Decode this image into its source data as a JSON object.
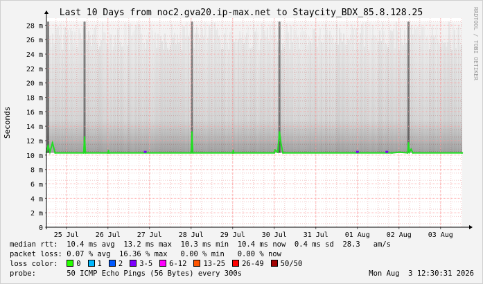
{
  "title": "Last 10 Days from noc2.gva20.ip-max.net to Staycity_BDX_85.8.128.25",
  "side_label": "RRDTOOL / TOBI OETIKER",
  "chart_data": {
    "type": "area",
    "ylabel": "Seconds",
    "ylim": [
      0,
      0.029
    ],
    "yticks": [
      {
        "v": 0,
        "label": "0"
      },
      {
        "v": 0.002,
        "label": "2 m"
      },
      {
        "v": 0.004,
        "label": "4 m"
      },
      {
        "v": 0.006,
        "label": "6 m"
      },
      {
        "v": 0.008,
        "label": "8 m"
      },
      {
        "v": 0.01,
        "label": "10 m"
      },
      {
        "v": 0.012,
        "label": "12 m"
      },
      {
        "v": 0.014,
        "label": "14 m"
      },
      {
        "v": 0.016,
        "label": "16 m"
      },
      {
        "v": 0.018,
        "label": "18 m"
      },
      {
        "v": 0.02,
        "label": "20 m"
      },
      {
        "v": 0.022,
        "label": "22 m"
      },
      {
        "v": 0.024,
        "label": "24 m"
      },
      {
        "v": 0.026,
        "label": "26 m"
      },
      {
        "v": 0.028,
        "label": "28 m"
      }
    ],
    "xlim": [
      "2026-07-24T12:30",
      "2026-08-03T12:30"
    ],
    "xticks": [
      {
        "t": "2026-07-25T00:00",
        "label": "25 Jul"
      },
      {
        "t": "2026-07-26T00:00",
        "label": "26 Jul"
      },
      {
        "t": "2026-07-27T00:00",
        "label": "27 Jul"
      },
      {
        "t": "2026-07-28T00:00",
        "label": "28 Jul"
      },
      {
        "t": "2026-07-29T00:00",
        "label": "29 Jul"
      },
      {
        "t": "2026-07-30T00:00",
        "label": "30 Jul"
      },
      {
        "t": "2026-07-31T00:00",
        "label": "31 Jul"
      },
      {
        "t": "2026-08-01T00:00",
        "label": "01 Aug"
      },
      {
        "t": "2026-08-02T00:00",
        "label": "02 Aug"
      },
      {
        "t": "2026-08-03T00:00",
        "label": "03 Aug"
      }
    ],
    "series": [
      {
        "name": "median rtt",
        "color": "#22dd22",
        "points": [
          [
            "2026-07-24T12:30",
            0.0104
          ],
          [
            "2026-07-24T13:30",
            0.0113
          ],
          [
            "2026-07-24T14:30",
            0.0104
          ],
          [
            "2026-07-24T16:00",
            0.0117
          ],
          [
            "2026-07-24T17:30",
            0.0103
          ],
          [
            "2026-07-25T10:00",
            0.0103
          ],
          [
            "2026-07-25T10:30",
            0.0125
          ],
          [
            "2026-07-25T11:00",
            0.0103
          ],
          [
            "2026-07-26T00:00",
            0.0103
          ],
          [
            "2026-07-26T00:20",
            0.0106
          ],
          [
            "2026-07-26T00:40",
            0.0103
          ],
          [
            "2026-07-28T00:00",
            0.0103
          ],
          [
            "2026-07-28T00:30",
            0.0132
          ],
          [
            "2026-07-28T01:00",
            0.0103
          ],
          [
            "2026-07-29T00:00",
            0.0103
          ],
          [
            "2026-07-29T00:20",
            0.0106
          ],
          [
            "2026-07-29T00:40",
            0.0103
          ],
          [
            "2026-07-30T00:00",
            0.0103
          ],
          [
            "2026-07-30T00:30",
            0.0107
          ],
          [
            "2026-07-30T02:00",
            0.0104
          ],
          [
            "2026-07-30T03:00",
            0.0132
          ],
          [
            "2026-07-30T04:00",
            0.0114
          ],
          [
            "2026-07-30T05:00",
            0.0103
          ],
          [
            "2026-08-01T20:00",
            0.0103
          ],
          [
            "2026-08-02T00:00",
            0.0104
          ],
          [
            "2026-08-02T00:30",
            0.0104
          ],
          [
            "2026-08-02T05:00",
            0.0103
          ],
          [
            "2026-08-02T05:30",
            0.0117
          ],
          [
            "2026-08-02T06:00",
            0.0104
          ],
          [
            "2026-08-02T07:00",
            0.0108
          ],
          [
            "2026-08-02T08:00",
            0.0103
          ],
          [
            "2026-08-03T12:30",
            0.0103
          ]
        ],
        "loss_markers": [
          {
            "t": "2026-07-26T21:30",
            "color": "#7e00ff"
          },
          {
            "t": "2026-08-01T00:00",
            "color": "#7e00ff"
          },
          {
            "t": "2026-08-01T17:00",
            "color": "#7e00ff"
          }
        ]
      }
    ],
    "smoke": {
      "base": 0.0103,
      "typical_top": 0.0285,
      "spikes": [
        "2026-07-24T13:30",
        "2026-07-25T10:30",
        "2026-07-28T00:30",
        "2026-07-30T03:00",
        "2026-08-02T05:30"
      ],
      "color": "#000000"
    }
  },
  "stats": {
    "median_rtt": {
      "label": "median rtt:",
      "text": "10.4 ms avg  13.2 ms max  10.3 ms min  10.4 ms now  0.4 ms sd  28.3   am/s"
    },
    "packet_loss": {
      "label": "packet loss:",
      "text": "0.07 % avg  16.36 % max   0.00 % min   0.00 % now"
    }
  },
  "loss_color": {
    "label": "loss color:",
    "items": [
      {
        "label": "0",
        "color": "#26ff00"
      },
      {
        "label": "1",
        "color": "#00b8ff"
      },
      {
        "label": "2",
        "color": "#0059ff"
      },
      {
        "label": "3-5",
        "color": "#7e00ff"
      },
      {
        "label": "6-12",
        "color": "#ff00ff"
      },
      {
        "label": "13-25",
        "color": "#ff5500"
      },
      {
        "label": "26-49",
        "color": "#ff0000"
      },
      {
        "label": "50/50",
        "color": "#a10000"
      }
    ]
  },
  "probe": {
    "label": "probe:",
    "text": "50 ICMP Echo Pings (56 Bytes) every 300s",
    "timestamp": "Mon Aug  3 12:30:31 2026"
  }
}
